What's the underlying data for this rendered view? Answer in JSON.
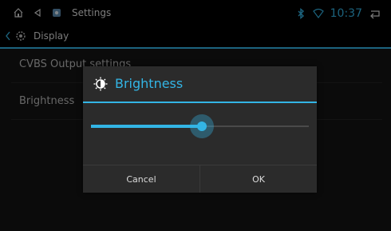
{
  "statusbar": {
    "app_title": "Settings",
    "time": "10:37",
    "icons": [
      "home-icon",
      "back-triangle-icon",
      "settings-app-icon",
      "bluetooth-icon",
      "wifi-icon",
      "return-icon"
    ]
  },
  "actionbar": {
    "title": "Display",
    "icons": [
      "chevron-left-icon",
      "gear-icon"
    ]
  },
  "list": {
    "items": [
      {
        "label": "CVBS Output settings"
      },
      {
        "label": "Brightness"
      }
    ]
  },
  "dialog": {
    "title": "Brightness",
    "icon": "brightness-icon",
    "slider_value": 0.51,
    "buttons": {
      "cancel": "Cancel",
      "ok": "OK"
    }
  },
  "colors": {
    "accent": "#33b5e5",
    "background": "#111111",
    "dialog": "#2b2b2b"
  }
}
